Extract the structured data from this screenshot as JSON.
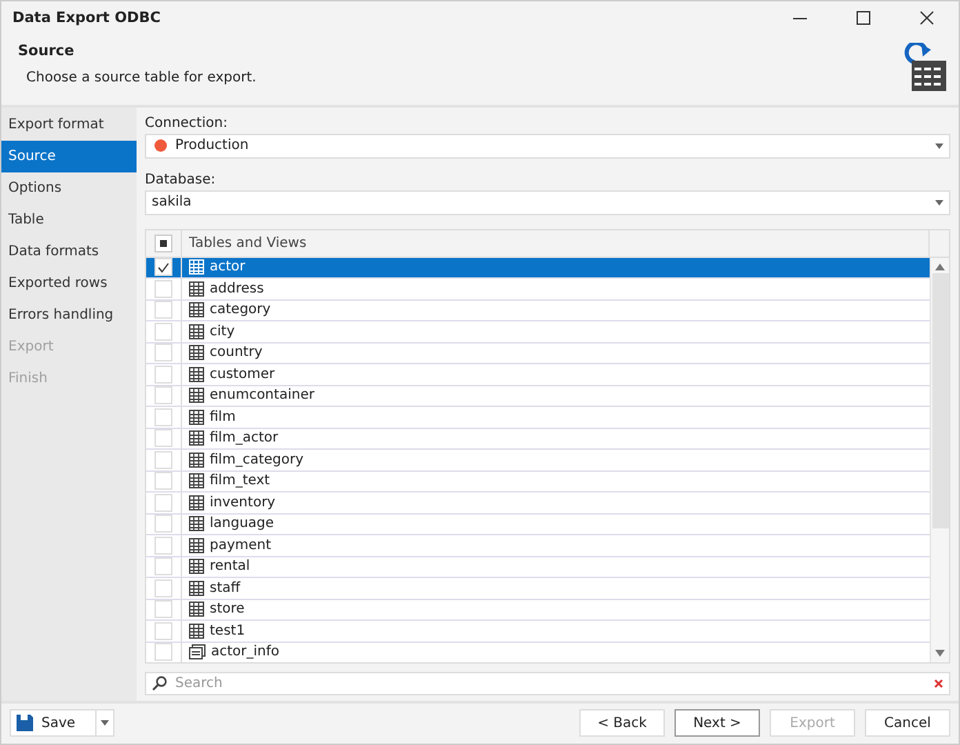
{
  "window": {
    "title": "Data Export ODBC"
  },
  "header": {
    "title": "Source",
    "subtitle": "Choose a source table for export."
  },
  "steps": [
    {
      "label": "Export format",
      "selected": false,
      "disabled": false
    },
    {
      "label": "Source",
      "selected": true,
      "disabled": false
    },
    {
      "label": "Options",
      "selected": false,
      "disabled": false
    },
    {
      "label": "Table",
      "selected": false,
      "disabled": false
    },
    {
      "label": "Data formats",
      "selected": false,
      "disabled": false
    },
    {
      "label": "Exported rows",
      "selected": false,
      "disabled": false
    },
    {
      "label": "Errors handling",
      "selected": false,
      "disabled": false
    },
    {
      "label": "Export",
      "selected": false,
      "disabled": true
    },
    {
      "label": "Finish",
      "selected": false,
      "disabled": true
    }
  ],
  "connection": {
    "label": "Connection:",
    "value": "Production",
    "color": "#f05a3c"
  },
  "database": {
    "label": "Database:",
    "value": "sakila"
  },
  "grid": {
    "column": "Tables and Views",
    "select_all": {
      "indeterminate": true
    },
    "rows": [
      {
        "name": "actor",
        "kind": "table",
        "checked": true,
        "selected": true
      },
      {
        "name": "address",
        "kind": "table",
        "checked": false,
        "selected": false
      },
      {
        "name": "category",
        "kind": "table",
        "checked": false,
        "selected": false
      },
      {
        "name": "city",
        "kind": "table",
        "checked": false,
        "selected": false
      },
      {
        "name": "country",
        "kind": "table",
        "checked": false,
        "selected": false
      },
      {
        "name": "customer",
        "kind": "table",
        "checked": false,
        "selected": false
      },
      {
        "name": "enumcontainer",
        "kind": "table",
        "checked": false,
        "selected": false
      },
      {
        "name": "film",
        "kind": "table",
        "checked": false,
        "selected": false
      },
      {
        "name": "film_actor",
        "kind": "table",
        "checked": false,
        "selected": false
      },
      {
        "name": "film_category",
        "kind": "table",
        "checked": false,
        "selected": false
      },
      {
        "name": "film_text",
        "kind": "table",
        "checked": false,
        "selected": false
      },
      {
        "name": "inventory",
        "kind": "table",
        "checked": false,
        "selected": false
      },
      {
        "name": "language",
        "kind": "table",
        "checked": false,
        "selected": false
      },
      {
        "name": "payment",
        "kind": "table",
        "checked": false,
        "selected": false
      },
      {
        "name": "rental",
        "kind": "table",
        "checked": false,
        "selected": false
      },
      {
        "name": "staff",
        "kind": "table",
        "checked": false,
        "selected": false
      },
      {
        "name": "store",
        "kind": "table",
        "checked": false,
        "selected": false
      },
      {
        "name": "test1",
        "kind": "table",
        "checked": false,
        "selected": false
      },
      {
        "name": "actor_info",
        "kind": "view",
        "checked": false,
        "selected": false
      }
    ]
  },
  "search": {
    "placeholder": "Search"
  },
  "footer": {
    "save": "Save",
    "buttons": [
      {
        "label": "< Back",
        "disabled": false,
        "default": false
      },
      {
        "label": "Next >",
        "disabled": false,
        "default": true
      },
      {
        "label": "Export",
        "disabled": true,
        "default": false
      },
      {
        "label": "Cancel",
        "disabled": false,
        "default": false
      }
    ]
  }
}
